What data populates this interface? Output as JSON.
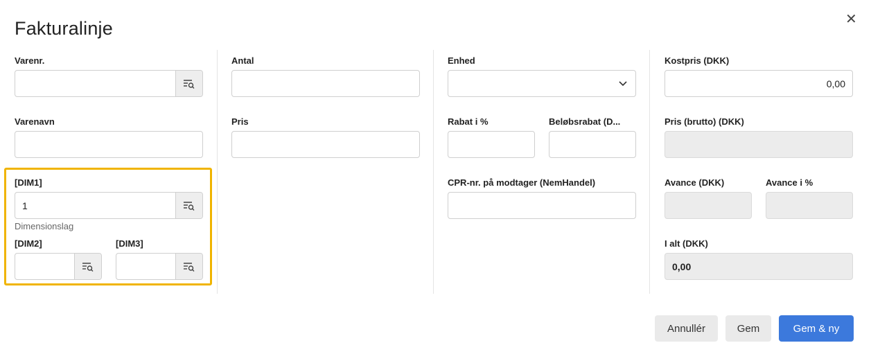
{
  "dialog": {
    "title": "Fakturalinje",
    "close_icon": "close-icon"
  },
  "col1": {
    "varenr_label": "Varenr.",
    "varenr_value": "",
    "varenavn_label": "Varenavn",
    "varenavn_value": "",
    "dim1_label": "[DIM1]",
    "dim1_value": "1",
    "dim1_hint": "Dimensionslag",
    "dim2_label": "[DIM2]",
    "dim2_value": "",
    "dim3_label": "[DIM3]",
    "dim3_value": ""
  },
  "col2": {
    "antal_label": "Antal",
    "antal_value": "",
    "pris_label": "Pris",
    "pris_value": ""
  },
  "col3": {
    "enhed_label": "Enhed",
    "enhed_value": "",
    "rabat_label": "Rabat i %",
    "rabat_value": "",
    "beloebsrabat_label": "Beløbsrabat (D...",
    "beloebsrabat_value": "",
    "cpr_label": "CPR-nr. på modtager (NemHandel)",
    "cpr_value": ""
  },
  "col4": {
    "kostpris_label": "Kostpris (DKK)",
    "kostpris_value": "0,00",
    "pris_brutto_label": "Pris (brutto) (DKK)",
    "pris_brutto_value": "",
    "avance_label": "Avance (DKK)",
    "avance_value": "",
    "avance_pct_label": "Avance i %",
    "avance_pct_value": "",
    "ialt_label": "I alt (DKK)",
    "ialt_value": "0,00"
  },
  "footer": {
    "cancel_label": "Annullér",
    "save_label": "Gem",
    "save_new_label": "Gem & ny"
  },
  "colors": {
    "accent": "#3c79dc",
    "highlight": "#f0b400"
  },
  "icons": {
    "lookup": "list-search-icon",
    "dropdown": "chevron-down-icon"
  }
}
